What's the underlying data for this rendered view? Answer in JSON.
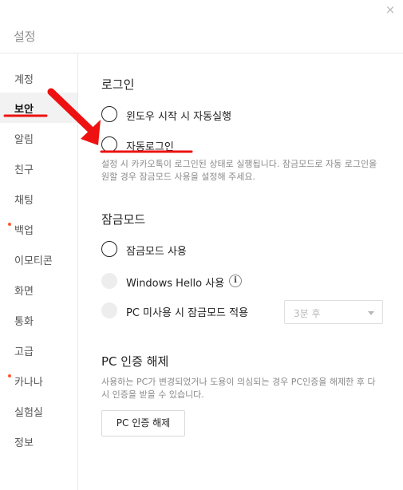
{
  "window": {
    "title": "설정",
    "close_label": "×"
  },
  "sidebar": {
    "items": [
      {
        "label": "계정",
        "active": false,
        "dot": false
      },
      {
        "label": "보안",
        "active": true,
        "dot": false
      },
      {
        "label": "알림",
        "active": false,
        "dot": false
      },
      {
        "label": "친구",
        "active": false,
        "dot": false
      },
      {
        "label": "채팅",
        "active": false,
        "dot": false
      },
      {
        "label": "백업",
        "active": false,
        "dot": true
      },
      {
        "label": "이모티콘",
        "active": false,
        "dot": false
      },
      {
        "label": "화면",
        "active": false,
        "dot": false
      },
      {
        "label": "통화",
        "active": false,
        "dot": false
      },
      {
        "label": "고급",
        "active": false,
        "dot": false
      },
      {
        "label": "카나나",
        "active": false,
        "dot": true
      },
      {
        "label": "실험실",
        "active": false,
        "dot": false
      },
      {
        "label": "정보",
        "active": false,
        "dot": false
      }
    ]
  },
  "login": {
    "title": "로그인",
    "option_startup": "윈도우 시작 시 자동실행",
    "option_autologin": "자동로그인",
    "description": "설정 시 카카오톡이 로그인된 상태로 실행됩니다. 잠금모드로 자동 로그인을 원할 경우 잠금모드 사용을 설정해 주세요."
  },
  "lockmode": {
    "title": "잠금모드",
    "option_use": "잠금모드 사용",
    "option_hello": "Windows Hello 사용",
    "info_icon": "i",
    "option_idle": "PC 미사용 시 잠금모드 적용",
    "idle_select_value": "3분 후"
  },
  "pc_auth": {
    "title": "PC 인증 해제",
    "description": "사용하는 PC가 변경되었거나 도용이 의심되는 경우 PC인증을 해제한 후 다시 인증을 받을 수 있습니다.",
    "button_label": "PC 인증 해제"
  },
  "annotation": {
    "color": "#ee1111"
  }
}
